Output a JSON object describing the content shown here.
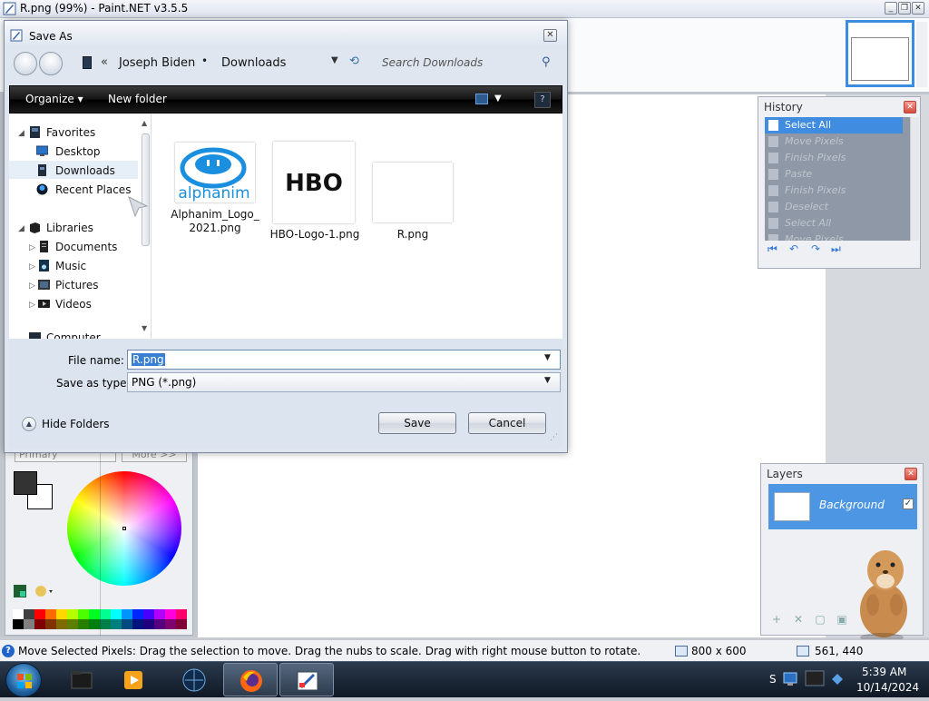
{
  "app": {
    "title": "R.png (99%) - Paint.NET v3.5.5",
    "window_controls": [
      "_",
      "❐",
      "✕"
    ]
  },
  "history": {
    "title": "History",
    "items": [
      {
        "label": "Select All",
        "icon": "select-all-icon",
        "selected": true
      },
      {
        "label": "Move Pixels",
        "icon": "move-pixels-icon",
        "selected": false
      },
      {
        "label": "Finish Pixels",
        "icon": "finish-pixels-icon",
        "selected": false
      },
      {
        "label": "Paste",
        "icon": "paste-icon",
        "selected": false
      },
      {
        "label": "Finish Pixels",
        "icon": "finish-pixels-icon",
        "selected": false
      },
      {
        "label": "Deselect",
        "icon": "deselect-icon",
        "selected": false
      },
      {
        "label": "Select All",
        "icon": "select-all-icon",
        "selected": false
      },
      {
        "label": "Move Pixels",
        "icon": "move-pixels-icon",
        "selected": false
      }
    ],
    "nav_icons": [
      "⏮",
      "↶",
      "↷",
      "⏭"
    ]
  },
  "layers": {
    "title": "Layers",
    "layer_name": "Background",
    "checked_glyph": "✓",
    "tool_icons": [
      "+",
      "✕",
      "▢",
      "▣"
    ]
  },
  "colors": {
    "select_value": "Primary",
    "more_label": "More >>",
    "primary_color": "#333333",
    "secondary_color": "#ffffff",
    "palette_row1": [
      "#ffffff",
      "#404040",
      "#ff0000",
      "#ff6a00",
      "#ffd800",
      "#b6ff00",
      "#4cff00",
      "#00ff21",
      "#00ff90",
      "#00ffff",
      "#0094ff",
      "#0026ff",
      "#4800ff",
      "#b200ff",
      "#ff00dc",
      "#ff006e"
    ],
    "palette_row2": [
      "#000000",
      "#808080",
      "#7f0000",
      "#7f3300",
      "#7f6a00",
      "#5b7f00",
      "#267f00",
      "#007f0e",
      "#007f46",
      "#007f7f",
      "#004a7f",
      "#00137f",
      "#21007f",
      "#57007f",
      "#7f006e",
      "#7f0037"
    ]
  },
  "status": {
    "message": "Move Selected Pixels: Drag the selection to move. Drag the nubs to scale. Drag with right mouse button to rotate.",
    "image_size": "800 x 600",
    "cursor_pos": "561, 440"
  },
  "taskbar": {
    "time": "5:39 AM",
    "date": "10/14/2024",
    "tray_label": "S"
  },
  "dialog": {
    "title": "Save As",
    "close_glyph": "✕",
    "breadcrumb": [
      "Joseph Biden",
      "Downloads"
    ],
    "breadcrumb_prefix": "«",
    "breadcrumb_sep": "•",
    "search_placeholder": "Search Downloads",
    "organize_label": "Organize ▾",
    "new_folder_label": "New folder",
    "tree": {
      "favorites": "Favorites",
      "desktop": "Desktop",
      "downloads": "Downloads",
      "recent_places": "Recent Places",
      "libraries": "Libraries",
      "documents": "Documents",
      "music": "Music",
      "pictures": "Pictures",
      "videos": "Videos",
      "computer": "Computer"
    },
    "files": [
      {
        "name": "Alphanim_Logo_2021.png",
        "line1": "Alphanim_Logo_",
        "line2": "2021.png",
        "logo_text": "alphanim"
      },
      {
        "name": "HBO-Logo-1.png",
        "line1": "HBO-Logo-1.png",
        "line2": "",
        "logo_text": "HBO"
      },
      {
        "name": "R.png",
        "line1": "R.png",
        "line2": "",
        "logo_text": ""
      }
    ],
    "filename_label": "File name:",
    "filename_value": "R.png",
    "savetype_label": "Save as type:",
    "savetype_value": "PNG (*.png)",
    "hide_folders_label": "Hide Folders",
    "save_label": "Save",
    "cancel_label": "Cancel"
  }
}
